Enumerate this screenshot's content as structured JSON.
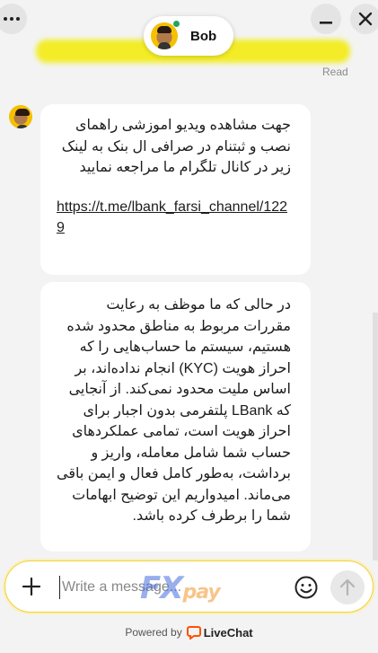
{
  "header": {
    "agent_name": "Bob",
    "read_status": "Read",
    "accent_color": "#f3ec1c",
    "online_color": "#27a35b"
  },
  "icons": {
    "menu": "more-dots-icon",
    "minimize": "minimize-icon",
    "close": "close-icon",
    "plus": "plus-icon",
    "emoji": "smiley-icon",
    "send": "arrow-up-icon",
    "brand": "livechat-logo-icon"
  },
  "messages": [
    {
      "text": "جهت مشاهده ویدیو اموزشی راهمای نصب و ثبتنام در صرافی ال بنک به لینک زیر در کانال تلگرام ما مراجعه نمایید",
      "link": "https://t.me/lbank_farsi_channel/1229"
    },
    {
      "text": "در حالی که ما موظف به رعایت مقررات مربوط به مناطق محدود شده هستیم، سیستم ما حساب‌هایی را که احراز هویت (KYC) انجام نداده‌اند، بر اساس ملیت محدود نمی‌کند. از آنجایی که LBank پلتفرمی بدون اجبار برای احراز هویت است، تمامی عملکردهای حساب شما شامل معامله، واریز و برداشت، به‌طور کامل فعال و ایمن باقی می‌ماند. امیدواریم این توضیح ابهامات شما را برطرف کرده باشد."
    }
  ],
  "composer": {
    "placeholder": "Write a message...",
    "value": "",
    "watermark_main": "FX",
    "watermark_sub": "pay"
  },
  "footer": {
    "powered_by": "Powered by",
    "brand": "LiveChat"
  }
}
